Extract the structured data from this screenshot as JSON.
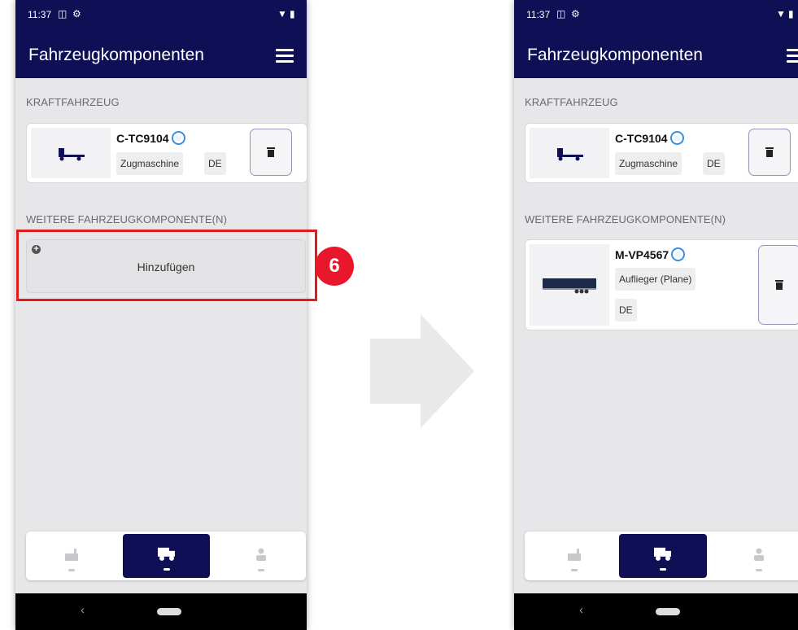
{
  "status": {
    "time": "11:37"
  },
  "app": {
    "title": "Fahrzeugkomponenten"
  },
  "sections": {
    "motor_vehicle": "KRAFTFAHRZEUG",
    "further": "WEITERE FAHRZEUGKOMPONENTE(N)"
  },
  "left": {
    "vehicle": {
      "plate": "C-TC9104",
      "type": "Zugmaschine",
      "country": "DE"
    },
    "add_label": "Hinzufügen"
  },
  "right": {
    "vehicle": {
      "plate": "C-TC9104",
      "type": "Zugmaschine",
      "country": "DE"
    },
    "component": {
      "plate": "M-VP4567",
      "type": "Auflieger (Plane)",
      "country": "DE"
    }
  },
  "step_badge": "6",
  "colors": {
    "appbar": "#0e0f55",
    "highlight": "#e41a1a",
    "badge": "#e8172b",
    "sync": "#3a8fe0"
  },
  "icons": {
    "truck": "tractor-unit-icon",
    "trailer": "trailer-icon",
    "trash": "trash-icon",
    "nav": [
      "factory-icon",
      "truck-icon",
      "person-icon"
    ]
  }
}
